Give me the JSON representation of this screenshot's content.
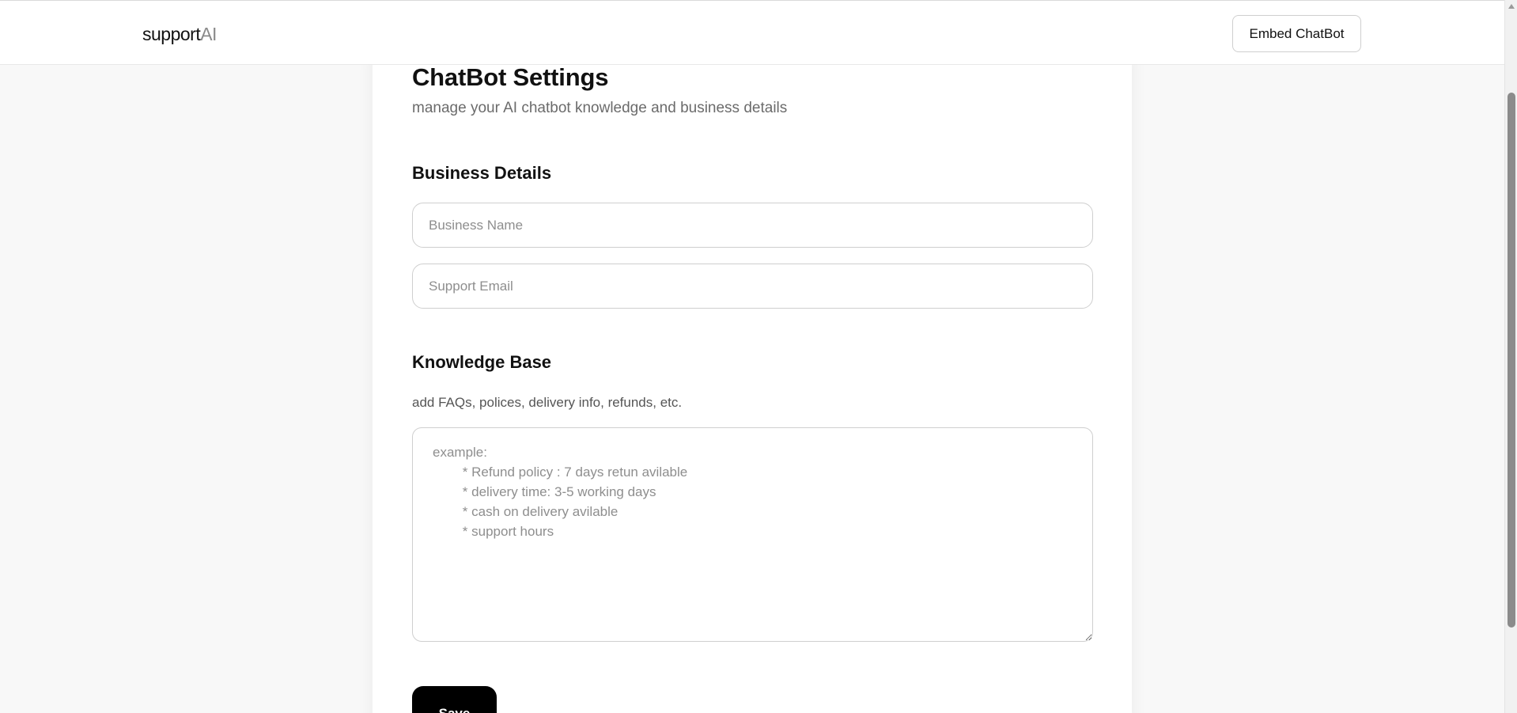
{
  "header": {
    "brand_main": "support",
    "brand_accent": "AI",
    "embed_button_label": "Embed ChatBot"
  },
  "main": {
    "title": "ChatBot Settings",
    "subtitle": "manage your AI chatbot knowledge and business details",
    "business_section": {
      "heading": "Business Details",
      "business_name": {
        "value": "",
        "placeholder": "Business Name"
      },
      "support_email": {
        "value": "",
        "placeholder": "Support Email"
      }
    },
    "knowledge_section": {
      "heading": "Knowledge Base",
      "helper": "add FAQs, polices, delivery info, refunds, etc.",
      "textarea": {
        "value": "",
        "placeholder": "example:\n        * Refund policy : 7 days retun avilable\n        * delivery time: 3-5 working days\n        * cash on delivery avilable\n        * support hours"
      }
    },
    "save_label": "Save"
  },
  "colors": {
    "accent": "#000000",
    "brand_accent": "#8a8a8a",
    "background": "#f8f8f8",
    "card": "#ffffff"
  },
  "icons": {
    "scroll_up": "chevron-up-icon",
    "resize_handle": "resize-grip-icon"
  }
}
